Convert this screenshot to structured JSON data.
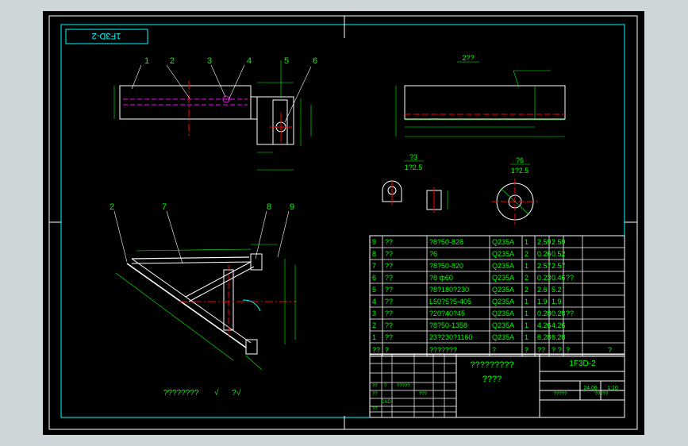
{
  "drawing": {
    "code_stamp": "1F3D-2",
    "balloons": [
      "1",
      "2",
      "3",
      "4",
      "5",
      "6",
      "2",
      "7",
      "8",
      "9"
    ],
    "top_right_view_title": "2??",
    "detail3_title": "?3",
    "detail3_scale": "1?2.5",
    "detail6_title": "?6",
    "detail6_scale": "1?2.5",
    "roughness_note": "????????",
    "roughness_suffix": "?"
  },
  "bom": {
    "rows": [
      {
        "no": "9",
        "name": "??",
        "spec": "?8?50-826",
        "material": "Q235A",
        "qty": "1",
        "unit": "2.59",
        "total": "2.59",
        "note": ""
      },
      {
        "no": "8",
        "name": "??",
        "spec": "?6",
        "material": "Q235A",
        "qty": "2",
        "unit": "0.26",
        "total": "0.52",
        "note": ""
      },
      {
        "no": "7",
        "name": "??",
        "spec": "?8?50-820",
        "material": "Q235A",
        "qty": "1",
        "unit": "2.57",
        "total": "2.57",
        "note": ""
      },
      {
        "no": "6",
        "name": "??",
        "spec": "?8 ф60",
        "material": "Q235A",
        "qty": "2",
        "unit": "0.23",
        "total": "0.46",
        "note": "??"
      },
      {
        "no": "5",
        "name": "??",
        "spec": "?8?180?230",
        "material": "Q235A",
        "qty": "2",
        "unit": "2.6",
        "total": "5.2",
        "note": ""
      },
      {
        "no": "4",
        "name": "??",
        "spec": "L50?5?5-405",
        "material": "Q235A",
        "qty": "1",
        "unit": "1.9",
        "total": "1.9",
        "note": ""
      },
      {
        "no": "3",
        "name": "??",
        "spec": "?20?40?45",
        "material": "Q235A",
        "qty": "1",
        "unit": "0.28",
        "total": "0.28",
        "note": "??"
      },
      {
        "no": "2",
        "name": "??",
        "spec": "?8?50-1358",
        "material": "Q235A",
        "qty": "1",
        "unit": "4.26",
        "total": "4.26",
        "note": ""
      },
      {
        "no": "1",
        "name": "??",
        "spec": "23?230?1160",
        "material": "Q235A",
        "qty": "1",
        "unit": "6.28",
        "total": "6.28",
        "note": ""
      }
    ],
    "header": {
      "no": "??",
      "name": "?",
      "spec": "???????",
      "material": "?",
      "qty": "?",
      "unit": "??",
      "total": "?\n?",
      "note_a": "?",
      "note_b": "?"
    }
  },
  "title_block": {
    "drawing_title_1": "?????????",
    "drawing_title_2": "????",
    "drawing_code": "1F3D-2",
    "weight": "24.06",
    "scale": "1:10",
    "cad_label": "CAD",
    "sheet_a": "?????",
    "sheet_b": "?????",
    "marks_small": [
      "??",
      "?",
      "?",
      "?????",
      "??",
      "??",
      "???",
      "?",
      "?"
    ]
  },
  "colors": {
    "frame": "#ffffff",
    "grid": "#00ffff",
    "text": "#00ff00",
    "outline": "#ffffff",
    "centerline": "#ff0000",
    "hidden": "#ff00ff",
    "dimension": "#00ff00",
    "cyan": "#00ffff",
    "background": "#000000"
  }
}
